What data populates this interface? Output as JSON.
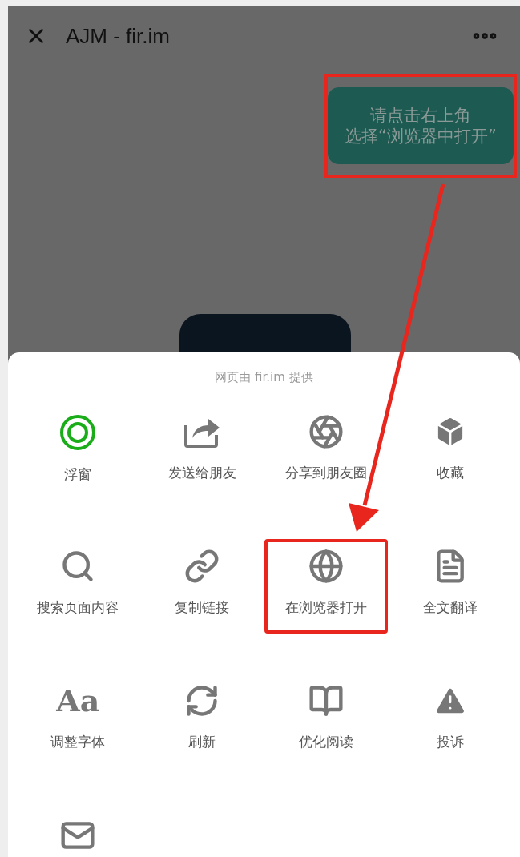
{
  "header": {
    "title": "AJM - fir.im"
  },
  "tooltip": {
    "lines": [
      "请点击右上角",
      "选择“浏览器中打开”"
    ],
    "annotated": true
  },
  "sheet": {
    "caption": "网页由 fir.im 提供",
    "items": [
      {
        "kind": "labeled",
        "label": "浮窗",
        "annotated": false
      },
      {
        "kind": "labeled",
        "label": "发送给朋友",
        "annotated": false
      },
      {
        "kind": "labeled",
        "label": "分享到朋友圈",
        "annotated": false
      },
      {
        "kind": "labeled",
        "label": "收藏",
        "annotated": false
      },
      {
        "kind": "labeled",
        "label": "搜索页面内容",
        "annotated": false
      },
      {
        "kind": "labeled",
        "label": "复制链接",
        "annotated": false
      },
      {
        "kind": "labeled",
        "label": "在浏览器打开",
        "annotated": true
      },
      {
        "kind": "labeled",
        "label": "全文翻译",
        "annotated": false
      },
      {
        "kind": "labeled",
        "label": "调整字体",
        "glyph": "Aa",
        "annotated": false
      },
      {
        "kind": "labeled",
        "label": "刷新",
        "annotated": false
      },
      {
        "kind": "labeled",
        "label": "优化阅读",
        "annotated": false
      },
      {
        "kind": "labeled",
        "label": "投诉",
        "annotated": false
      },
      {
        "kind": "icon_only",
        "annotated": false
      }
    ]
  }
}
